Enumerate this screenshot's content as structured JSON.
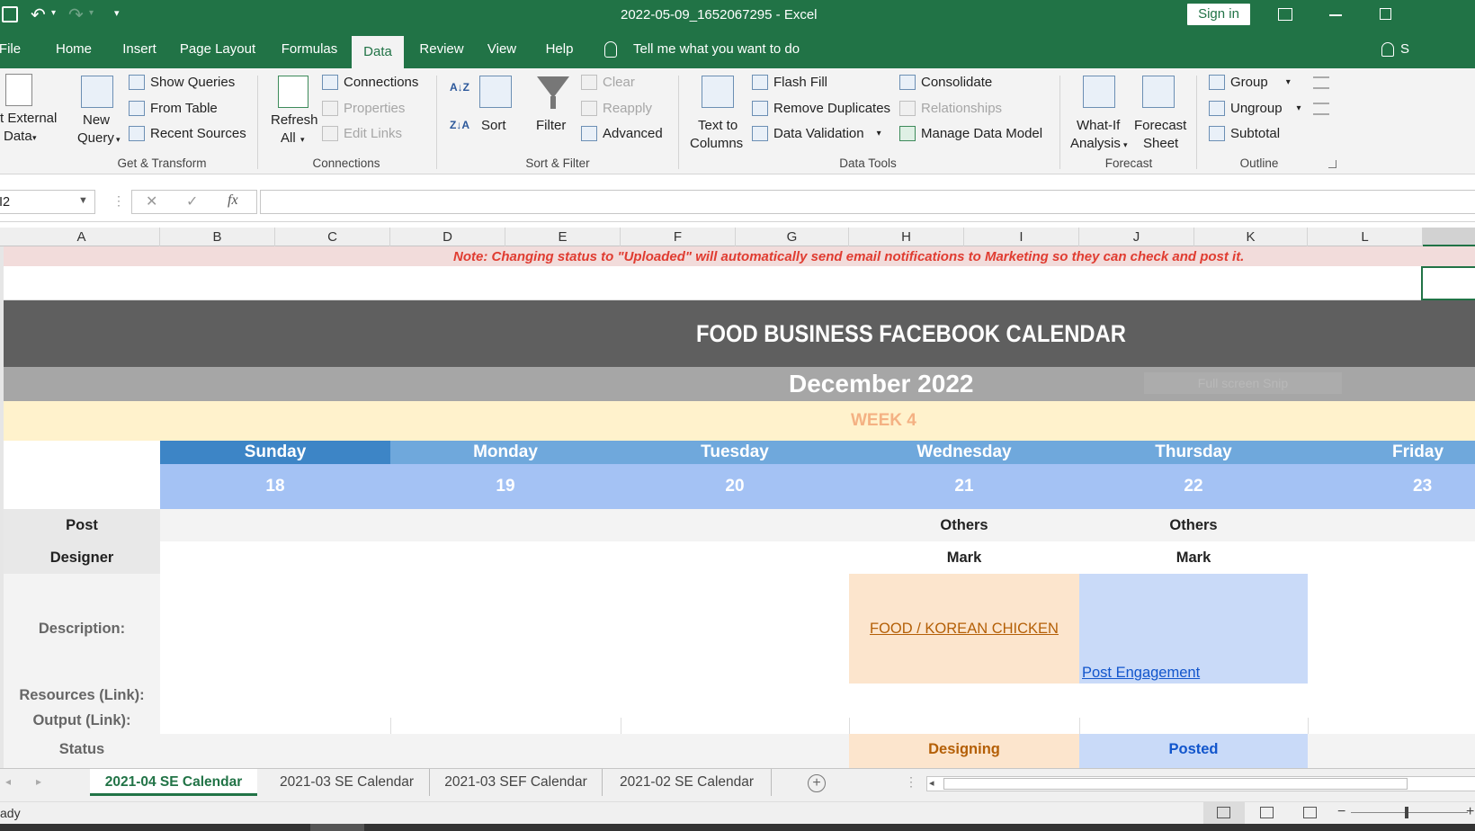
{
  "window": {
    "title": "2022-05-09_1652067295 - Excel",
    "sign_in": "Sign in"
  },
  "ribbon_tabs": [
    "File",
    "Home",
    "Insert",
    "Page Layout",
    "Formulas",
    "Data",
    "Review",
    "View",
    "Help"
  ],
  "tell_me": "Tell me what you want to do",
  "tab_extra": "S",
  "ribbon": {
    "get_transform": {
      "external_data_line1": "t External",
      "external_data_line2": "Data",
      "new_query_line1": "New",
      "new_query_line2": "Query",
      "show_queries": "Show Queries",
      "from_table": "From Table",
      "recent_sources": "Recent Sources",
      "group_name": "Get & Transform"
    },
    "connections": {
      "refresh_line1": "Refresh",
      "refresh_line2": "All",
      "connections": "Connections",
      "properties": "Properties",
      "edit_links": "Edit Links",
      "group_name": "Connections"
    },
    "sort_filter": {
      "sort_az": "A↓Z",
      "sort_za": "Z↓A",
      "sort": "Sort",
      "filter": "Filter",
      "clear": "Clear",
      "reapply": "Reapply",
      "advanced": "Advanced",
      "group_name": "Sort & Filter"
    },
    "data_tools": {
      "text_to_columns_line1": "Text to",
      "text_to_columns_line2": "Columns",
      "flash_fill": "Flash Fill",
      "remove_duplicates": "Remove Duplicates",
      "data_validation": "Data Validation",
      "consolidate": "Consolidate",
      "relationships": "Relationships",
      "manage_data_model": "Manage Data Model",
      "group_name": "Data Tools"
    },
    "forecast": {
      "what_if_line1": "What-If",
      "what_if_line2": "Analysis",
      "forecast_sheet_line1": "Forecast",
      "forecast_sheet_line2": "Sheet",
      "group_name": "Forecast"
    },
    "outline": {
      "group": "Group",
      "ungroup": "Ungroup",
      "subtotal": "Subtotal",
      "group_name": "Outline"
    }
  },
  "formula_bar": {
    "name_box": "I2",
    "fx": "fx",
    "cancel": "✕",
    "enter": "✓"
  },
  "columns": [
    "A",
    "B",
    "C",
    "D",
    "E",
    "F",
    "G",
    "H",
    "I",
    "J",
    "K",
    "L"
  ],
  "sheet": {
    "note": "Note: Changing status to \"Uploaded\" will automatically send email notifications to Marketing so they can check and post it.",
    "title": "FOOD BUSINESS FACEBOOK CALENDAR",
    "month": "December 2022",
    "faded_hint": "Full screen Snip",
    "week": "WEEK 4",
    "days": [
      {
        "name": "Sunday",
        "date": "18"
      },
      {
        "name": "Monday",
        "date": "19"
      },
      {
        "name": "Tuesday",
        "date": "20"
      },
      {
        "name": "Wednesday",
        "date": "21"
      },
      {
        "name": "Thursday",
        "date": "22"
      },
      {
        "name": "Friday",
        "date": "23"
      }
    ],
    "row_labels": {
      "post": "Post",
      "designer": "Designer",
      "description": "Description:",
      "resources": "Resources (Link):",
      "output": "Output (Link):",
      "status": "Status"
    },
    "wednesday": {
      "post": "Others",
      "designer": "Mark",
      "description": "FOOD / KOREAN CHICKEN",
      "status": "Designing"
    },
    "thursday": {
      "post": "Others",
      "designer": "Mark",
      "description": "Post Engagement",
      "status": "Posted"
    }
  },
  "sheet_tabs": [
    "2021-04 SE Calendar",
    "2021-03 SE Calendar",
    "2021-03 SEF Calendar",
    "2021-02 SE Calendar"
  ],
  "status_bar": {
    "ready": "ady"
  },
  "colors": {
    "excel_green": "#217346",
    "title_band": "#5f5f5f",
    "month_band": "#a6a6a6",
    "week_band": "#fff2cc",
    "week_text": "#f4b183",
    "day_header": "#6fa8dc",
    "day_header_active": "#3d85c6",
    "date_row": "#a4c2f4",
    "designing": "#fce5cd",
    "posted": "#c9daf8",
    "note_text": "#e03c31",
    "note_bg": "#f2dcdb"
  }
}
